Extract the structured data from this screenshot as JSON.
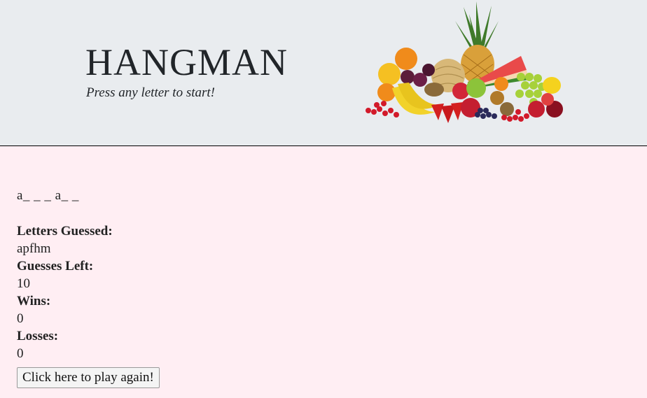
{
  "header": {
    "title": "HANGMAN",
    "subtitle": "Press any letter to start!",
    "image_icon": "fruit-pile-icon"
  },
  "game": {
    "word": "a_ _ _ a_ _",
    "letters_guessed_label": "Letters Guessed:",
    "letters_guessed": "apfhm",
    "guesses_left_label": "Guesses Left:",
    "guesses_left": "10",
    "wins_label": "Wins:",
    "wins": "0",
    "losses_label": "Losses:",
    "losses": "0",
    "play_again_label": "Click here to play again!"
  },
  "colors": {
    "header_bg": "#e9ecef",
    "main_bg": "#ffeef3"
  }
}
